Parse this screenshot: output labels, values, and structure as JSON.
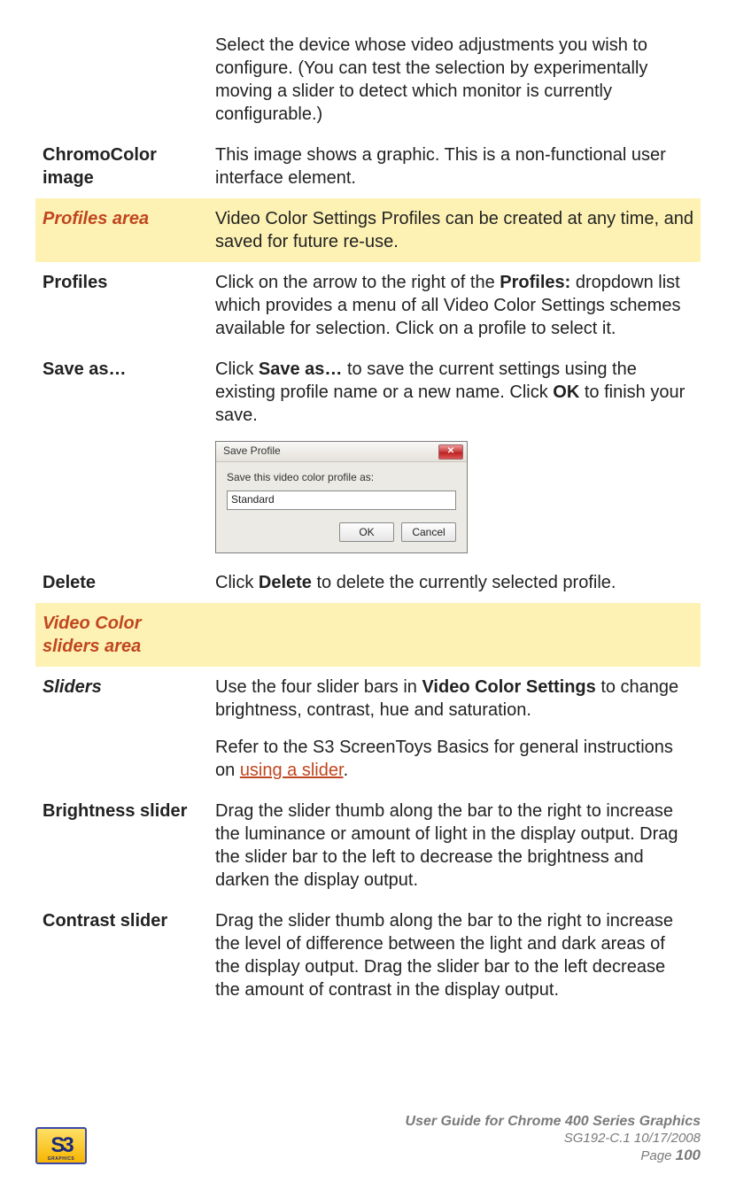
{
  "rows": {
    "r0": {
      "term": "",
      "desc": "Select the device whose video adjustments you wish to configure. (You can test the selection by experimentally moving a slider to detect which monitor is currently configurable.)"
    },
    "chromocolor": {
      "term": "ChromoColor image",
      "desc": "This image shows a graphic. This is a non-functional user interface element."
    },
    "profiles_area": {
      "term": "Profiles area",
      "desc": "Video Color Settings Profiles can be created at any time, and saved for future re-use."
    },
    "profiles": {
      "term": "Profiles",
      "pre": "Click on the arrow to the right of the ",
      "bold": "Profiles:",
      "post": " dropdown list which provides a menu of all Video Color Settings schemes available for selection. Click on a profile to select it."
    },
    "saveas": {
      "term": "Save as…",
      "pre1": "Click ",
      "bold1": "Save as…",
      "mid": " to save the current settings using the existing profile name or a new name. Click ",
      "bold2": "OK",
      "post": " to finish your save."
    },
    "delete": {
      "term": "Delete",
      "pre": "Click ",
      "bold": "Delete",
      "post": " to delete the currently selected profile."
    },
    "vcs_area": {
      "term": "Video Color sliders area",
      "desc": ""
    },
    "sliders": {
      "term": "Sliders",
      "p1_pre": "Use the four slider bars in ",
      "p1_bold": "Video Color Settings",
      "p1_post": " to change brightness, contrast, hue and saturation.",
      "p2_pre": "Refer to the S3 ScreenToys Basics for general instructions on ",
      "p2_link": "using a slider",
      "p2_post": "."
    },
    "brightness": {
      "term": "Brightness slider",
      "desc": "Drag the slider thumb along the bar to the right to increase the luminance or amount of light in the display output. Drag the slider bar to the left to decrease the brightness and darken the display output."
    },
    "contrast": {
      "term": "Contrast slider",
      "desc": "Drag the slider thumb along the bar to the right to increase the level of difference between the light and dark areas of the display output. Drag the slider bar to the left decrease the amount of contrast in the display output."
    }
  },
  "dialog": {
    "title": "Save Profile",
    "label": "Save this video color profile as:",
    "value": "Standard",
    "ok": "OK",
    "cancel": "Cancel",
    "close_x": "✕"
  },
  "footer": {
    "title": "User Guide for Chrome 400 Series Graphics",
    "meta": "SG192-C.1   10/17/2008",
    "page_label": "Page ",
    "page_num": "100",
    "logo_text": "S3",
    "logo_sub": "GRAPHICS"
  }
}
